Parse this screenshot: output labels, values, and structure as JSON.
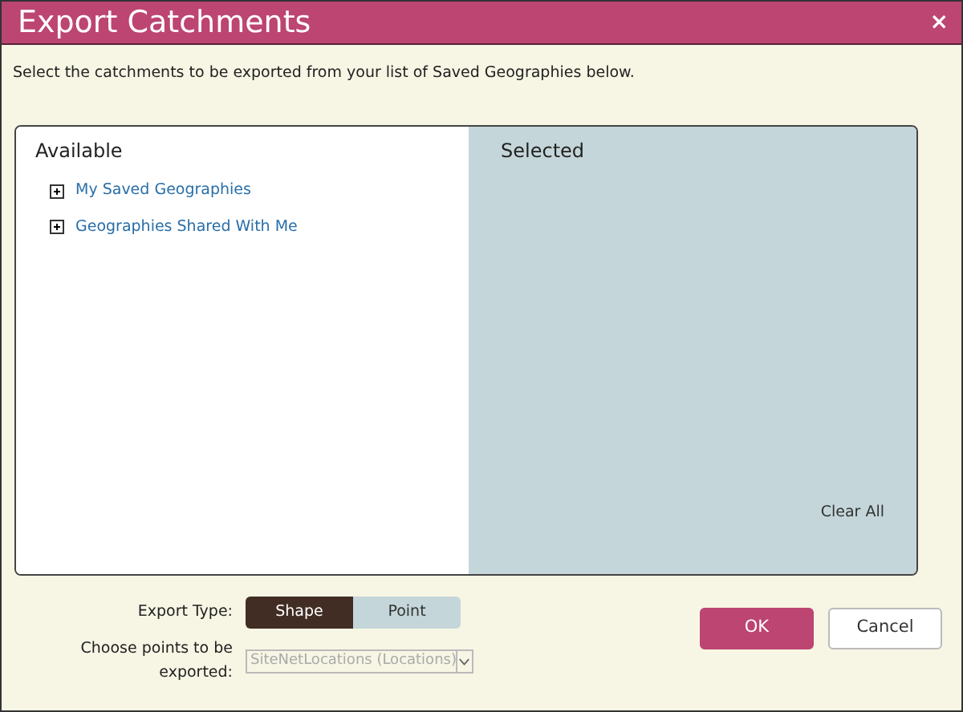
{
  "window": {
    "title": "Export Catchments",
    "close": "×"
  },
  "instruction": "Select the catchments to be exported from your list of Saved Geographies below.",
  "available": {
    "title": "Available",
    "items": [
      {
        "label": "My Saved Geographies",
        "expanded": false
      },
      {
        "label": "Geographies Shared With Me",
        "expanded": false
      }
    ]
  },
  "selected": {
    "title": "Selected",
    "clear": "Clear All"
  },
  "export_type": {
    "label": "Export Type:",
    "options": [
      {
        "label": "Shape",
        "selected": true
      },
      {
        "label": "Point",
        "selected": false
      }
    ]
  },
  "points": {
    "label": "Choose points to be exported:",
    "value": "SiteNetLocations (Locations)",
    "disabled": true
  },
  "buttons": [
    {
      "label": "OK",
      "kind": "primary"
    },
    {
      "label": "Cancel",
      "kind": "secondary"
    }
  ]
}
